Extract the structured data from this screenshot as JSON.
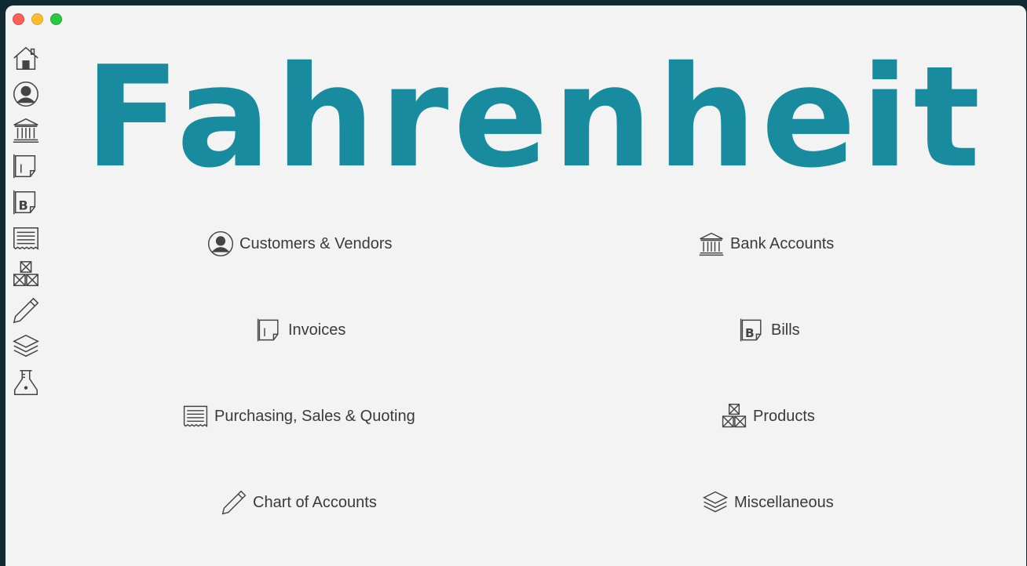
{
  "app": {
    "logo_text": "Fahrenheit"
  },
  "sidebar": {
    "items": [
      {
        "icon": "home-icon"
      },
      {
        "icon": "user-icon"
      },
      {
        "icon": "bank-icon"
      },
      {
        "icon": "invoice-icon"
      },
      {
        "icon": "bill-icon"
      },
      {
        "icon": "receipt-icon"
      },
      {
        "icon": "boxes-icon"
      },
      {
        "icon": "pen-icon"
      },
      {
        "icon": "layers-icon"
      },
      {
        "icon": "flask-icon"
      }
    ]
  },
  "menu": {
    "customers": "Customers & Vendors",
    "bank": "Bank Accounts",
    "invoices": "Invoices",
    "bills": "Bills",
    "purchasing": "Purchasing, Sales & Quoting",
    "products": "Products",
    "chart": "Chart of Accounts",
    "misc": "Miscellaneous"
  },
  "colors": {
    "brand": "#188c9e",
    "window_bg": "#f3f3f3",
    "desktop_bg": "#0f2a33",
    "icon_stroke": "#444444"
  }
}
